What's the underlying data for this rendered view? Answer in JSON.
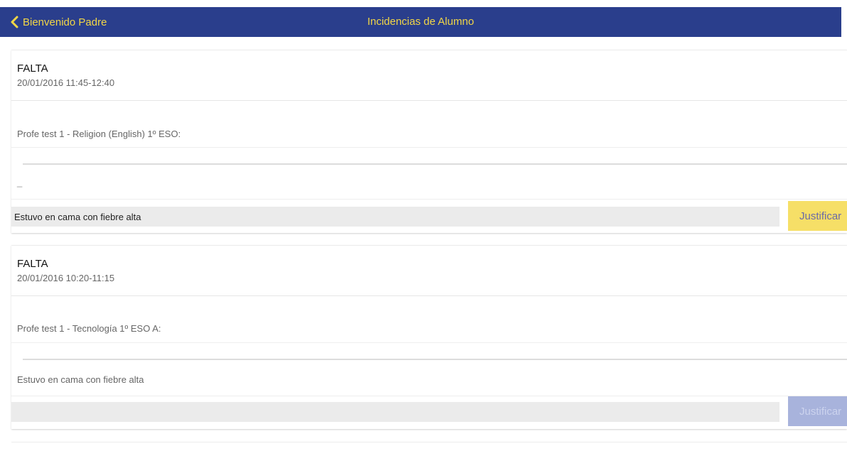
{
  "navbar": {
    "back_label": "Bienvenido Padre",
    "title": "Incidencias de Alumno",
    "background": "#2a3e8c",
    "text_color": "#f2d646"
  },
  "incidents": [
    {
      "type": "FALTA",
      "datetime": "20/01/2016 11:45-12:40",
      "teacher_subject": "Profe test 1 - Religion (English) 1º ESO:",
      "comment": "_",
      "reason_value": "Estuvo en cama con fiebre alta",
      "justify_label": "Justificar",
      "justify_state": "active"
    },
    {
      "type": "FALTA",
      "datetime": "20/01/2016 10:20-11:15",
      "teacher_subject": "Profe test 1 - Tecnología 1º ESO A:",
      "comment": "Estuvo en cama con fiebre alta",
      "reason_value": "",
      "justify_label": "Justificar",
      "justify_state": "disabled"
    }
  ]
}
